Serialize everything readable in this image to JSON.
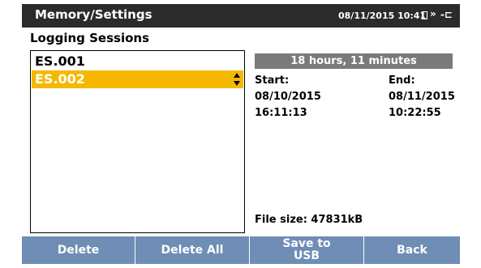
{
  "header": {
    "title": "Memory/Settings",
    "datetime": "08/11/2015 10:41",
    "icons": [
      "battery-icon",
      "wireless-icon",
      "power-plug-icon"
    ]
  },
  "section_title": "Logging Sessions",
  "sessions": [
    {
      "label": "ES.001",
      "selected": false
    },
    {
      "label": "ES.002",
      "selected": true
    }
  ],
  "details": {
    "duration": "18 hours, 11 minutes",
    "start_label": "Start:",
    "start_date": "08/10/2015",
    "start_time": "16:11:13",
    "end_label": "End:",
    "end_date": "08/11/2015",
    "end_time": "10:22:55",
    "file_size": "File size: 47831kB"
  },
  "buttons": {
    "delete": "Delete",
    "delete_all": "Delete All",
    "save_to_usb": "Save to\nUSB",
    "back": "Back"
  },
  "colors": {
    "header_bg": "#2b2b2b",
    "selection": "#f5b800",
    "duration_bg": "#7a7a7a",
    "button_bg": "#6f8db5"
  }
}
